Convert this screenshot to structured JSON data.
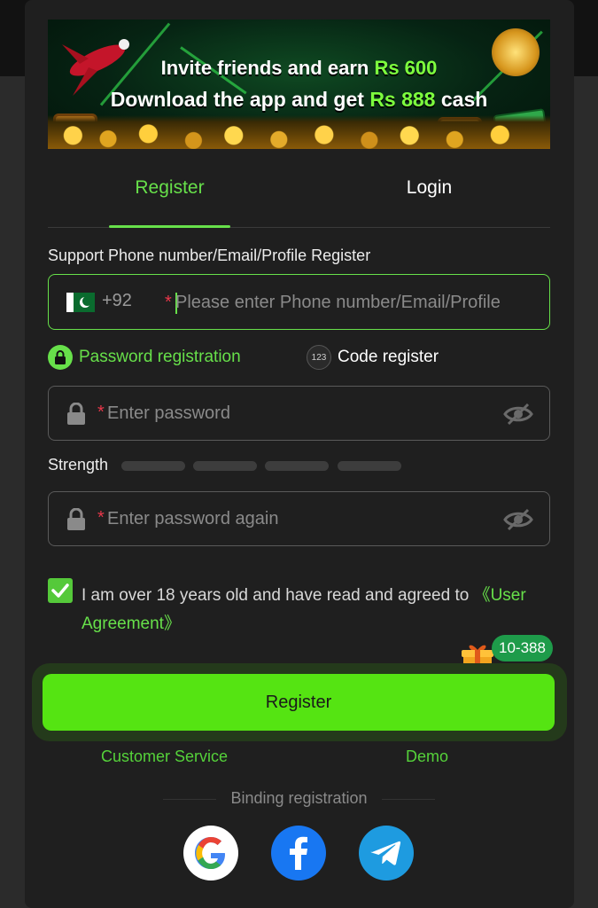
{
  "banner": {
    "line1_text": "Invite friends and earn ",
    "line1_amount": "Rs 600",
    "line2_text": "Download the app and get ",
    "line2_amount": "Rs 888",
    "line2_suffix": " cash"
  },
  "tabs": [
    {
      "label": "Register",
      "active": true
    },
    {
      "label": "Login",
      "active": false
    }
  ],
  "account": {
    "label": "Support Phone number/Email/Profile Register",
    "country_code": "+92",
    "required_mark": "*",
    "placeholder": "Please enter Phone number/Email/Profile",
    "value": ""
  },
  "register_modes": [
    {
      "label": "Password registration",
      "icon": "lock-icon",
      "selected": true
    },
    {
      "label": "Code register",
      "icon": "123-icon",
      "icon_text": "123",
      "selected": false
    }
  ],
  "password": {
    "required_mark": "*",
    "placeholder": "Enter password",
    "value": ""
  },
  "strength": {
    "label": "Strength",
    "segments": 4,
    "level": 0
  },
  "password_again": {
    "required_mark": "*",
    "placeholder": "Enter password again",
    "value": ""
  },
  "agreement": {
    "checked": true,
    "text": "I am over 18 years old and have read and agreed to ",
    "link": "《User Agreement》"
  },
  "promo_badge": "10-388",
  "register_button": "Register",
  "footer_links": {
    "customer_service": "Customer Service",
    "demo": "Demo"
  },
  "binding_label": "Binding registration",
  "social": [
    "google-icon",
    "facebook-icon",
    "telegram-icon"
  ],
  "colors": {
    "accent": "#67e04a",
    "button": "#55e412",
    "background": "#1f1f1f",
    "required": "#e8374a"
  }
}
